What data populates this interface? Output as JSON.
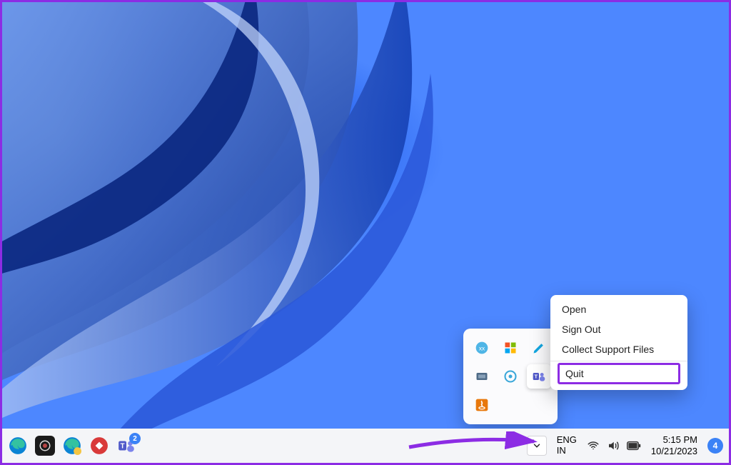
{
  "context_menu": {
    "items": [
      "Open",
      "Sign Out",
      "Collect Support Files"
    ],
    "quit": "Quit"
  },
  "taskbar": {
    "language": {
      "line1": "ENG",
      "line2": "IN"
    },
    "time": "5:15 PM",
    "date": "10/21/2023",
    "action_center_count": "4",
    "teams_badge": "2",
    "apps": [
      "edge",
      "obs",
      "edge-alt",
      "nordpass",
      "teams"
    ]
  },
  "tray": {
    "icons": [
      "chat",
      "security",
      "pen",
      "hardware",
      "driver",
      "teams",
      "java"
    ]
  },
  "colors": {
    "accent": "#8c2ce4"
  }
}
